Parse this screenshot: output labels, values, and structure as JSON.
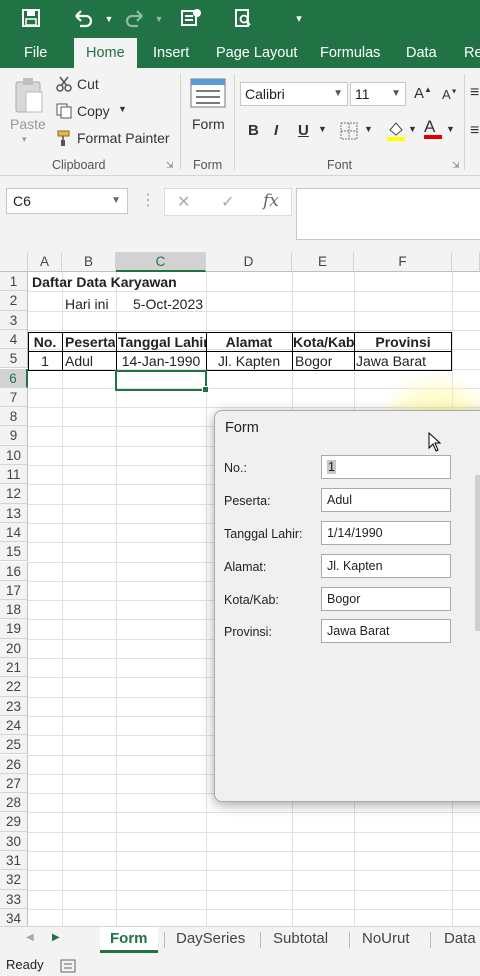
{
  "qat": {
    "save_icon": "save-icon",
    "undo_icon": "undo-icon",
    "redo_icon": "redo-icon",
    "form_icon": "form-icon",
    "print_preview_icon": "print-preview-icon",
    "customize_icon": "customize-icon"
  },
  "tabs": [
    "File",
    "Home",
    "Insert",
    "Page Layout",
    "Formulas",
    "Data",
    "Re"
  ],
  "ribbon": {
    "paste": "Paste",
    "cut": "Cut",
    "copy": "Copy",
    "format_painter": "Format Painter",
    "clipboard": "Clipboard",
    "form": "Form",
    "form_group": "Form",
    "font_name": "Calibri",
    "font_size": "11",
    "font_group": "Font",
    "bold": "B",
    "italic": "I",
    "underline": "U",
    "grow_font": "A",
    "shrink_font": "A",
    "font_color": "A",
    "align_partial": "≡"
  },
  "formula_bar": {
    "name_box": "C6",
    "cancel": "✕",
    "enter": "✓",
    "fx": "fx",
    "content": ""
  },
  "columns": [
    "A",
    "B",
    "C",
    "D",
    "E",
    "F"
  ],
  "rows": [
    "1",
    "2",
    "3",
    "4",
    "5",
    "6",
    "7",
    "8",
    "9",
    "10",
    "11",
    "12",
    "13",
    "14",
    "15",
    "16",
    "17",
    "18",
    "19",
    "20",
    "21",
    "22",
    "23",
    "24",
    "25",
    "26",
    "27",
    "28",
    "29",
    "30",
    "31",
    "32",
    "33",
    "34"
  ],
  "sheet": {
    "title": "Daftar Data Karyawan",
    "today_label": "Hari ini",
    "today_value": "5-Oct-2023",
    "headers": [
      "No.",
      "Peserta",
      "Tanggal Lahir",
      "Alamat",
      "Kota/Kab",
      "Provinsi"
    ],
    "row5": [
      "1",
      "Adul",
      "14-Jan-1990",
      "Jl. Kapten",
      "Bogor",
      "Jawa Barat"
    ]
  },
  "dialog": {
    "title": "Form",
    "fields": [
      {
        "label": "No.:",
        "value": "1"
      },
      {
        "label": "Peserta:",
        "value": "Adul"
      },
      {
        "label": "Tanggal Lahir:",
        "value": "1/14/1990"
      },
      {
        "label": "Alamat:",
        "value": "Jl. Kapten"
      },
      {
        "label": "Kota/Kab:",
        "value": "Bogor"
      },
      {
        "label": "Provinsi:",
        "value": "Jawa Barat"
      }
    ]
  },
  "sheet_tabs": [
    "Form",
    "DaySeries",
    "Subtotal",
    "NoUrut",
    "Data"
  ],
  "status": "Ready",
  "colors": {
    "accent": "#217346",
    "ribbon_bg": "#f3f3f3"
  }
}
